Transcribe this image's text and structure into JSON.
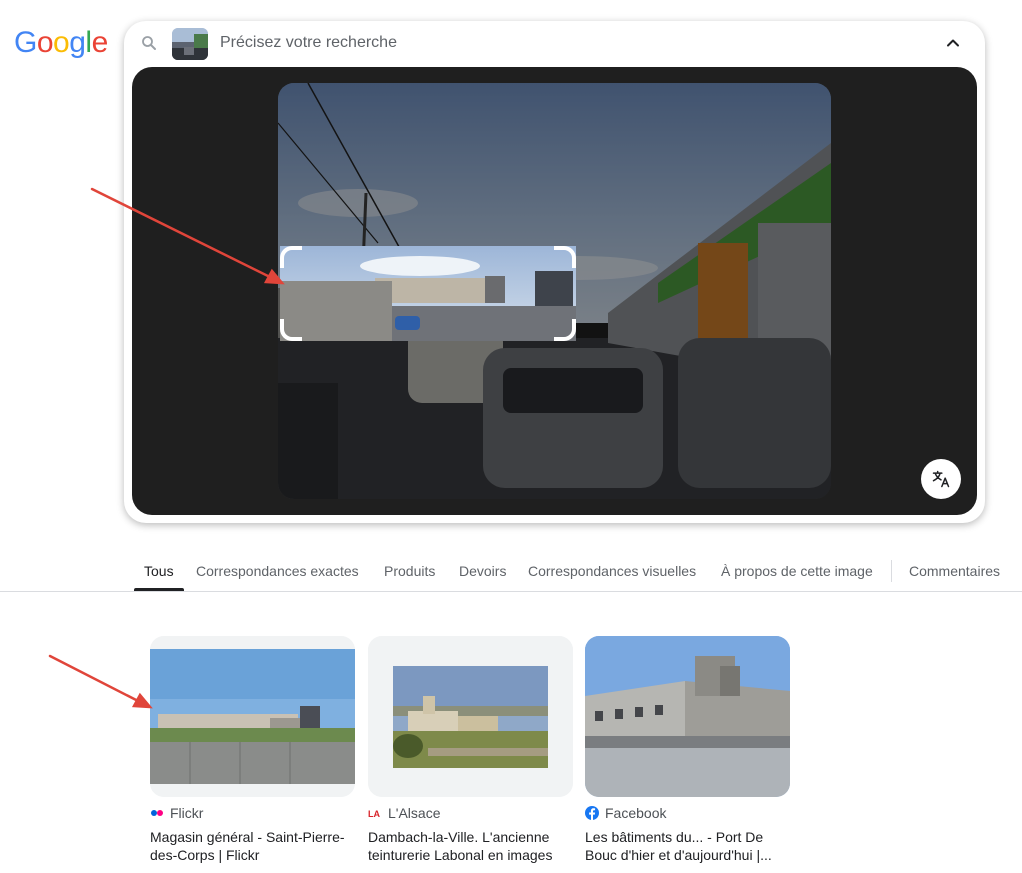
{
  "logo": {
    "letters": [
      "G",
      "o",
      "o",
      "g",
      "l",
      "e"
    ],
    "colors": [
      "#4285F4",
      "#EA4335",
      "#FBBC05",
      "#4285F4",
      "#34A853",
      "#EA4335"
    ]
  },
  "search": {
    "placeholder": "Précisez votre recherche",
    "search_icon": "search-icon",
    "collapse_icon": "chevron-up-icon"
  },
  "viewer": {
    "translate_icon": "translate-icon"
  },
  "tabs": [
    {
      "label": "Tous",
      "active": true
    },
    {
      "label": "Correspondances exactes",
      "active": false
    },
    {
      "label": "Produits",
      "active": false
    },
    {
      "label": "Devoirs",
      "active": false
    },
    {
      "label": "Correspondances visuelles",
      "active": false
    },
    {
      "label": "À propos de cette image",
      "active": false
    },
    {
      "label": "Commentaires",
      "active": false
    }
  ],
  "results": [
    {
      "source": "Flickr",
      "title": "Magasin général - Saint-Pierre-des-Corps | Flickr",
      "icon": "flickr-icon"
    },
    {
      "source": "L'Alsace",
      "title": "Dambach-la-Ville. L'ancienne teinturerie Labonal en images",
      "icon": "lalsace-icon"
    },
    {
      "source": "Facebook",
      "title": "Les bâtiments du... - Port De Bouc d'hier et d'aujourd'hui |...",
      "icon": "facebook-icon"
    }
  ],
  "annotation_color": "#e0453a"
}
